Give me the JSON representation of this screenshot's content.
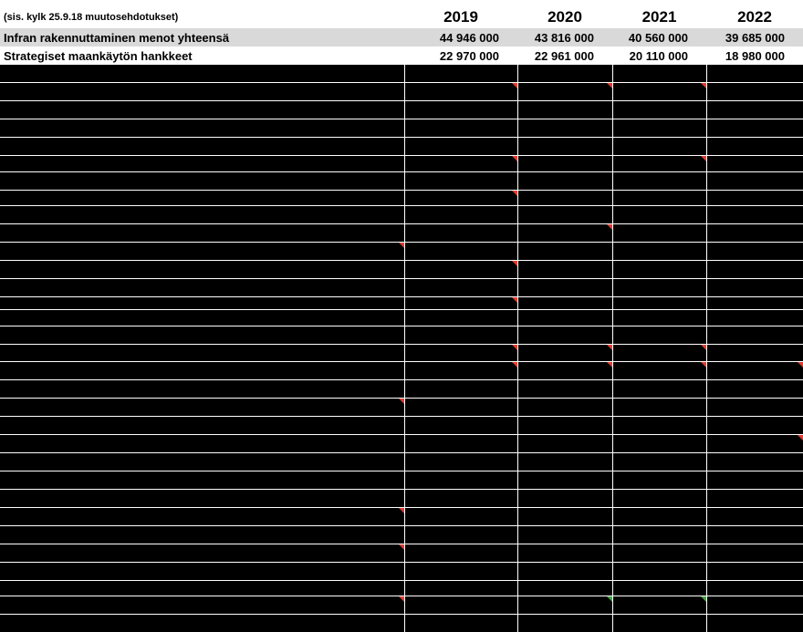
{
  "header": {
    "note": "(sis. kylk 25.9.18 muutosehdotukset)",
    "years": [
      "2019",
      "2020",
      "2021",
      "2022"
    ]
  },
  "rows": [
    {
      "label": "Infran rakennuttaminen menot yhteensä",
      "values": [
        "44 946 000",
        "43 816 000",
        "40 560 000",
        "39 685 000"
      ]
    },
    {
      "label": "Strategiset maankäytön hankkeet",
      "values": [
        "22 970 000",
        "22 961 000",
        "20 110 000",
        "18 980 000"
      ]
    }
  ],
  "colors": {
    "background": "#000000",
    "gridline": "#ffffff",
    "total_row": "#d9d9d9",
    "comment_marker": "#e23b2e",
    "green_marker": "#3ea53e"
  },
  "icons": [
    "comment-indicator-icon"
  ]
}
